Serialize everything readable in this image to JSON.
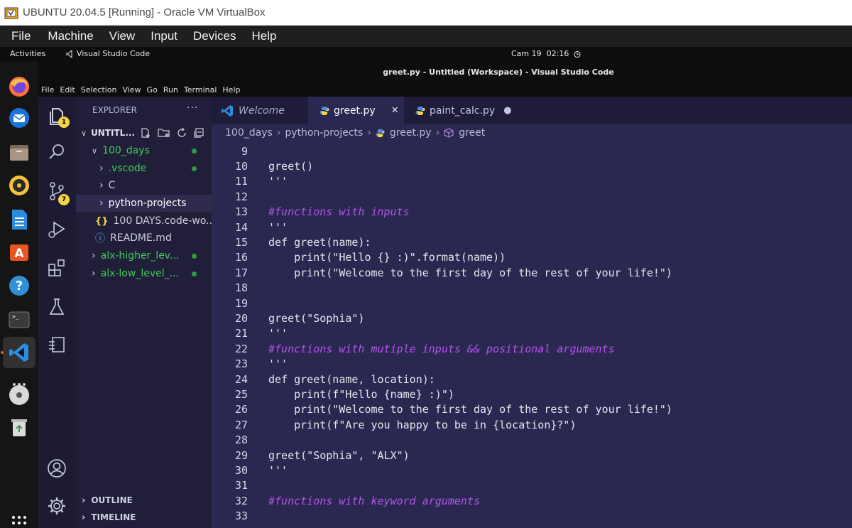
{
  "host_window": {
    "title": "UBUNTU 20.04.5 [Running] - Oracle VM VirtualBox",
    "menu": [
      "File",
      "Machine",
      "View",
      "Input",
      "Devices",
      "Help"
    ]
  },
  "ubuntu_topbar": {
    "activities": "Activities",
    "app_name": "Visual Studio Code",
    "clock": "Cam 19  02:16"
  },
  "dock": {
    "items": [
      "firefox-icon",
      "thunderbird-icon",
      "files-icon",
      "rhythmbox-icon",
      "writer-icon",
      "software-icon",
      "help-icon",
      "terminal-icon",
      "vscode-icon",
      "more-apps-icon",
      "dvd-icon",
      "trash-icon",
      "show-apps-icon"
    ]
  },
  "vscode": {
    "window_title": "greet.py - Untitled (Workspace) - Visual Studio Code",
    "menu": [
      "File",
      "Edit",
      "Selection",
      "View",
      "Go",
      "Run",
      "Terminal",
      "Help"
    ],
    "activity_badges": {
      "explorer": "1",
      "source_control": "7"
    },
    "explorer": {
      "header": "EXPLORER",
      "more": "···",
      "workspace": "UNTITL...",
      "tree": [
        {
          "label": "100_days",
          "chevron": "∨",
          "color": "#3ecf5a",
          "dot": true
        },
        {
          "label": ".vscode",
          "chevron": "›",
          "color": "#3ecf5a",
          "dot": true
        },
        {
          "label": "C",
          "chevron": "›",
          "color": "#cfcfe0",
          "dot": false
        },
        {
          "label": "python-projects",
          "chevron": "›",
          "color": "#ffffff",
          "dot": false
        },
        {
          "label": "100 DAYS.code-wo...",
          "icon": "{}",
          "color": "#cfcfe0",
          "dot": false
        },
        {
          "label": "README.md",
          "icon": "ⓘ",
          "color": "#cfcfe0",
          "dot": false
        },
        {
          "label": "alx-higher_lev...",
          "chevron": "›",
          "color": "#3ecf5a",
          "dot": true
        },
        {
          "label": "alx-low_level_...",
          "chevron": "›",
          "color": "#3ecf5a",
          "dot": true
        }
      ],
      "outline": "OUTLINE",
      "timeline": "TIMELINE"
    },
    "tabs": [
      {
        "label": "Welcome"
      },
      {
        "label": "greet.py",
        "close": "✕"
      },
      {
        "label": "paint_calc.py",
        "dirty": "●"
      }
    ],
    "breadcrumb": [
      "100_days",
      "python-projects",
      "greet.py",
      "greet"
    ],
    "code_lines": [
      {
        "n": "9",
        "t": "",
        "c": false
      },
      {
        "n": "10",
        "t": "greet()",
        "c": false
      },
      {
        "n": "11",
        "t": "'''",
        "c": false
      },
      {
        "n": "12",
        "t": "",
        "c": false
      },
      {
        "n": "13",
        "t": "#functions with inputs",
        "c": true
      },
      {
        "n": "14",
        "t": "'''",
        "c": false
      },
      {
        "n": "15",
        "t": "def greet(name):",
        "c": false
      },
      {
        "n": "16",
        "t": "    print(\"Hello {} :)\".format(name))",
        "c": false
      },
      {
        "n": "17",
        "t": "    print(\"Welcome to the first day of the rest of your life!\")",
        "c": false
      },
      {
        "n": "18",
        "t": "",
        "c": false
      },
      {
        "n": "19",
        "t": "",
        "c": false
      },
      {
        "n": "20",
        "t": "greet(\"Sophia\")",
        "c": false
      },
      {
        "n": "21",
        "t": "'''",
        "c": false
      },
      {
        "n": "22",
        "t": "#functions with mutiple inputs && positional arguments",
        "c": true
      },
      {
        "n": "23",
        "t": "'''",
        "c": false
      },
      {
        "n": "24",
        "t": "def greet(name, location):",
        "c": false
      },
      {
        "n": "25",
        "t": "    print(f\"Hello {name} :)\")",
        "c": false
      },
      {
        "n": "26",
        "t": "    print(\"Welcome to the first day of the rest of your life!\")",
        "c": false
      },
      {
        "n": "27",
        "t": "    print(f\"Are you happy to be in {location}?\")",
        "c": false
      },
      {
        "n": "28",
        "t": "",
        "c": false
      },
      {
        "n": "29",
        "t": "greet(\"Sophia\", \"ALX\")",
        "c": false
      },
      {
        "n": "30",
        "t": "'''",
        "c": false
      },
      {
        "n": "31",
        "t": "",
        "c": false
      },
      {
        "n": "32",
        "t": "#functions with keyword arguments",
        "c": true
      },
      {
        "n": "33",
        "t": "",
        "c": false
      }
    ]
  }
}
